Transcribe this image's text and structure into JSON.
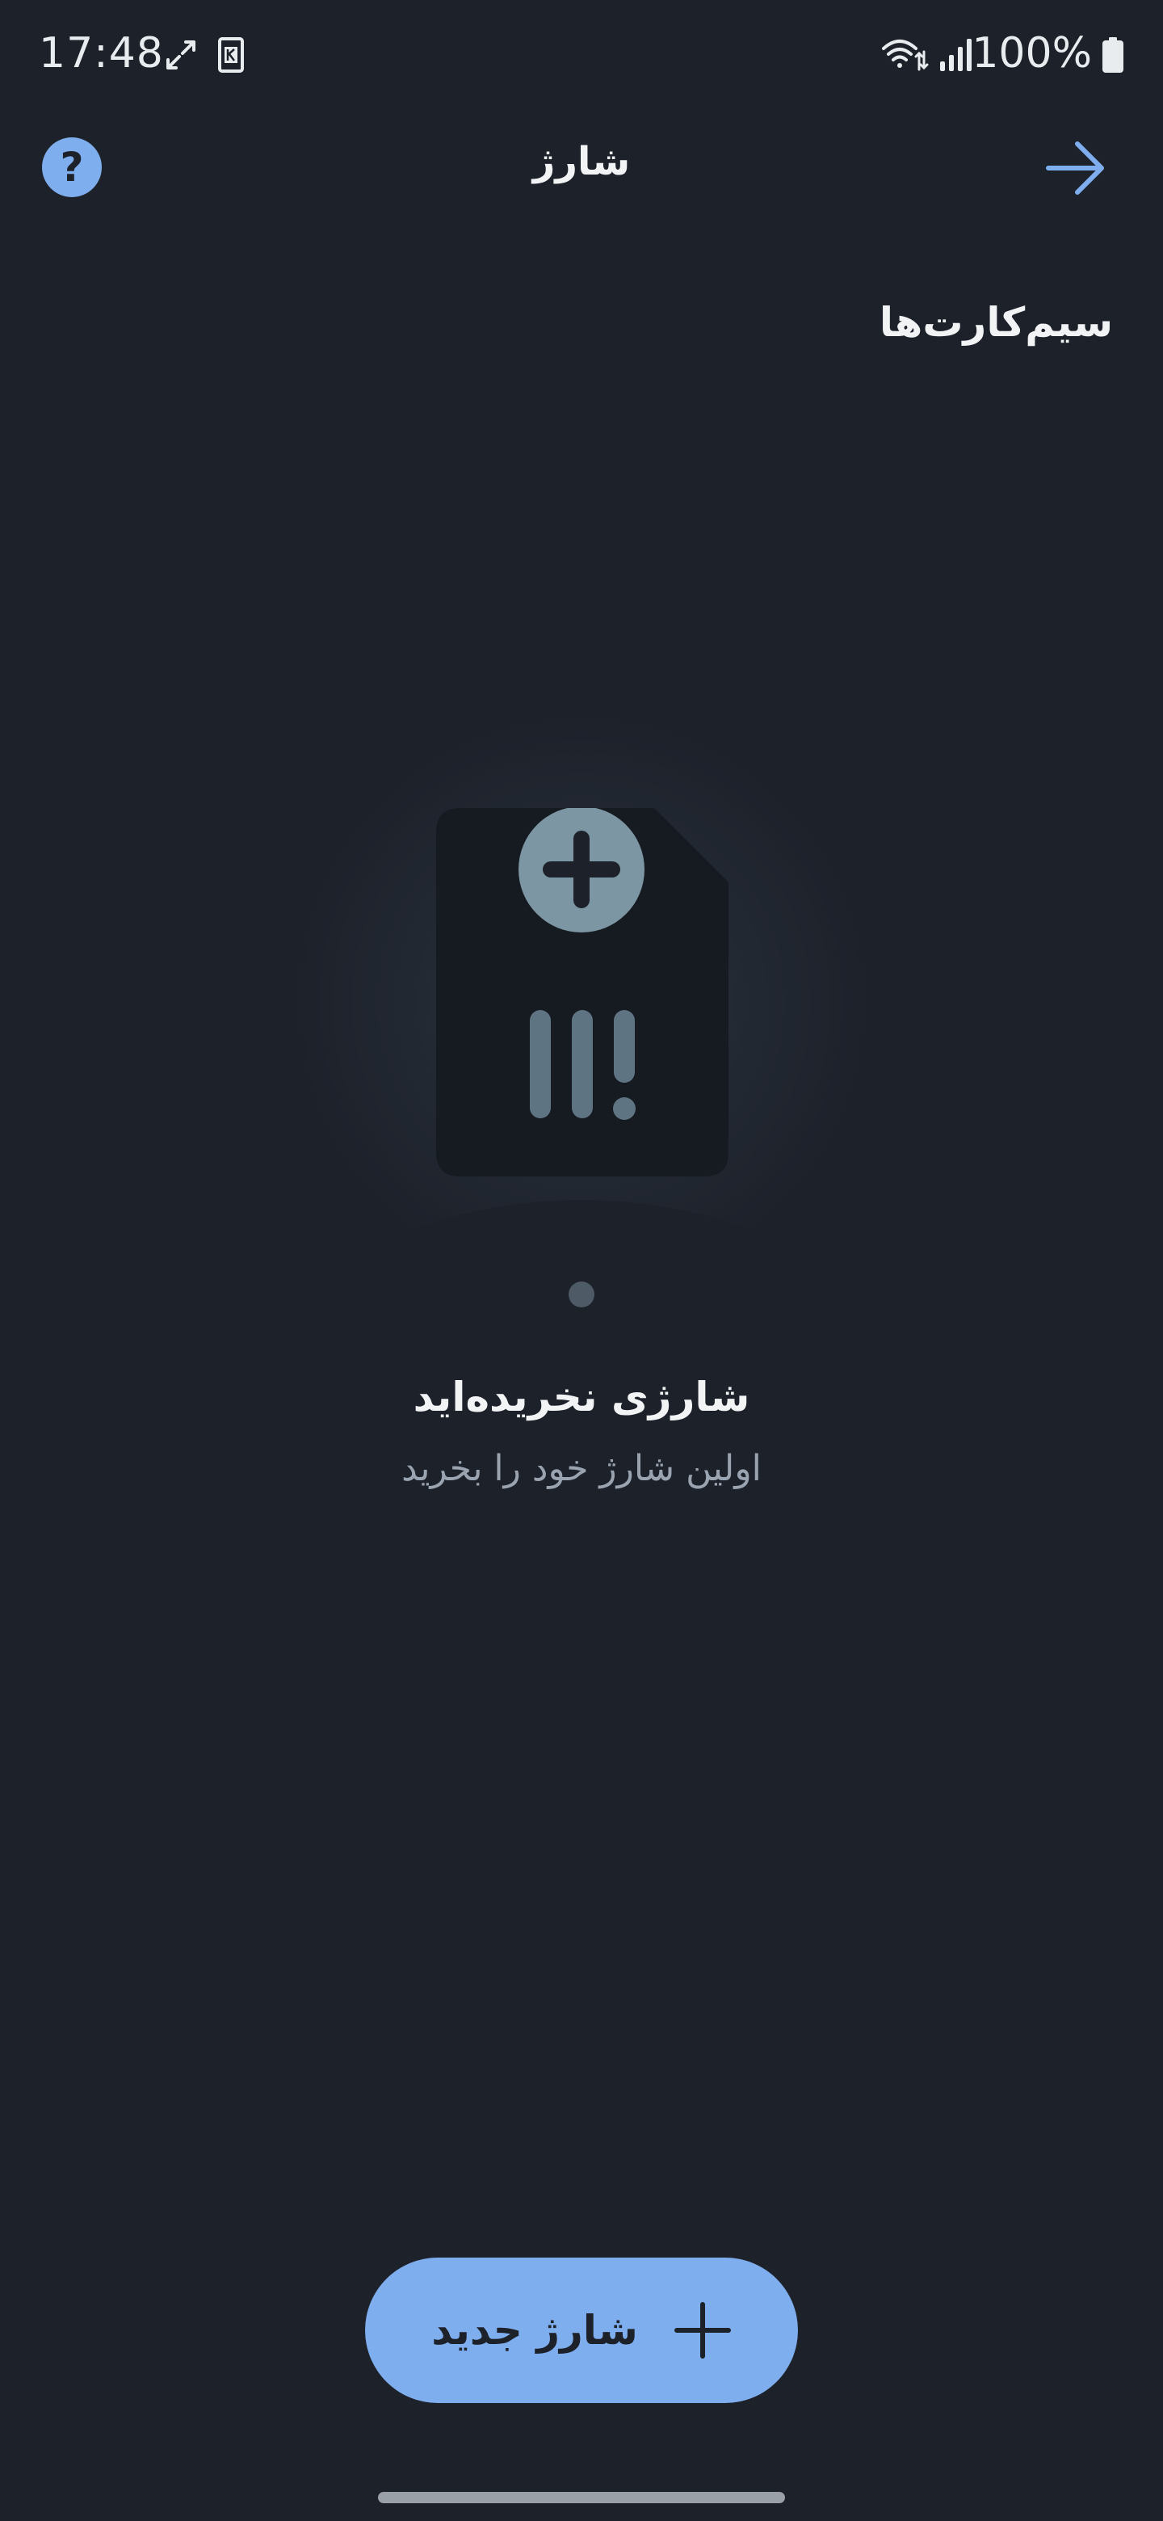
{
  "status_bar": {
    "time": "17:48",
    "battery": "100%",
    "icons": [
      "sync-icon",
      "sim-k-icon",
      "wifi-icon",
      "signal-icon",
      "battery-icon"
    ]
  },
  "app_bar": {
    "title": "شارژ",
    "help_label": "?",
    "help_icon": "question-icon",
    "back_icon": "arrow-right-icon"
  },
  "section": {
    "title": "سیم‌کارت‌ها"
  },
  "empty_state": {
    "illustration_icon": "sim-card-add-icon",
    "title": "شارژی نخریده‌اید",
    "subtitle": "اولین شارژ خود را بخرید"
  },
  "fab": {
    "label": "شارژ جدید",
    "icon": "plus-icon"
  },
  "colors": {
    "background": "#1d212a",
    "accent": "#7faeee",
    "text_primary": "#f1f3f5",
    "text_secondary": "#9aa4b1"
  }
}
